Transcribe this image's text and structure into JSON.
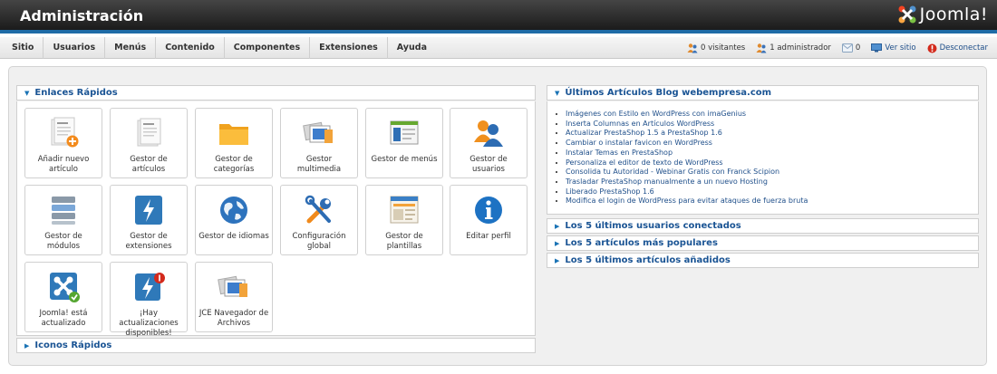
{
  "header": {
    "title": "Administración",
    "logo_text": "Joomla!"
  },
  "menu": [
    "Sitio",
    "Usuarios",
    "Menús",
    "Contenido",
    "Componentes",
    "Extensiones",
    "Ayuda"
  ],
  "status": {
    "visitors": "0 visitantes",
    "admins": "1 administrador",
    "messages": "0",
    "view_site": "Ver sitio",
    "logout": "Desconectar"
  },
  "quick_links": {
    "title": "Enlaces Rápidos",
    "items": [
      {
        "label": "Añadir nuevo artículo",
        "icon": "add-article-icon"
      },
      {
        "label": "Gestor de artículos",
        "icon": "articles-icon"
      },
      {
        "label": "Gestor de categorías",
        "icon": "folder-icon"
      },
      {
        "label": "Gestor multimedia",
        "icon": "media-icon"
      },
      {
        "label": "Gestor de menús",
        "icon": "menu-icon"
      },
      {
        "label": "Gestor de usuarios",
        "icon": "users-icon"
      },
      {
        "label": "Gestor de módulos",
        "icon": "modules-icon"
      },
      {
        "label": "Gestor de extensiones",
        "icon": "extensions-icon"
      },
      {
        "label": "Gestor de idiomas",
        "icon": "globe-icon"
      },
      {
        "label": "Configuración global",
        "icon": "tools-icon"
      },
      {
        "label": "Gestor de plantillas",
        "icon": "templates-icon"
      },
      {
        "label": "Editar perfil",
        "icon": "info-icon"
      },
      {
        "label": "Joomla! está actualizado",
        "icon": "joomla-updated-icon"
      },
      {
        "label": "¡Hay actualizaciones disponibles!",
        "icon": "updates-icon"
      },
      {
        "label": "JCE Navegador de Archivos",
        "icon": "file-browser-icon"
      }
    ]
  },
  "quick_icons": {
    "title": "Iconos Rápidos"
  },
  "blog": {
    "title": "Últimos Artículos Blog webempresa.com",
    "items": [
      "Imágenes con Estilo en WordPress con imaGenius",
      "Inserta Columnas en Artículos WordPress",
      "Actualizar PrestaShop 1.5 a PrestaShop 1.6",
      "Cambiar o instalar favicon en WordPress",
      "Instalar Temas en PrestaShop",
      "Personaliza el editor de texto de WordPress",
      "Consolida tu Autoridad - Webinar Gratis con Franck Scipion",
      "Trasladar PrestaShop manualmente a un nuevo Hosting",
      "Liberado PrestaShop 1.6",
      "Modifica el login de WordPress para evitar ataques de fuerza bruta"
    ]
  },
  "panels": {
    "last_users": "Los 5 últimos usuarios conectados",
    "popular": "Los 5 artículos más populares",
    "latest_added": "Los 5 últimos artículos añadidos"
  }
}
